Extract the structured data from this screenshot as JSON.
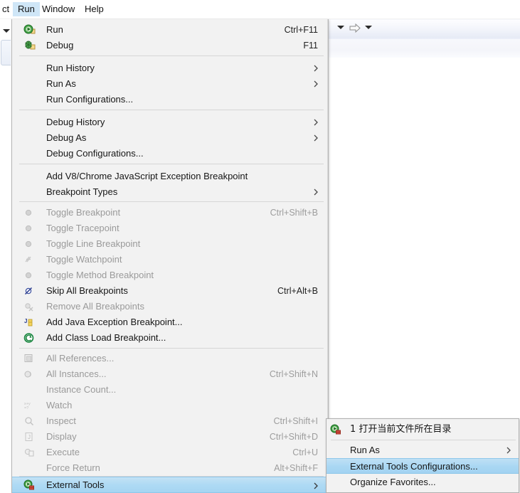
{
  "menubar": {
    "items": [
      {
        "label": "ct",
        "active": false
      },
      {
        "label": "Run",
        "active": true
      },
      {
        "label": "Window",
        "active": false
      },
      {
        "label": "Help",
        "active": false
      }
    ]
  },
  "toolbar": {
    "icons": [
      "caret-down-icon",
      "arrow-right-icon",
      "caret-down-icon"
    ]
  },
  "menu": {
    "title": "Run",
    "highlight_color": "#a9d7f3",
    "items": [
      {
        "label": "Run",
        "accel": "Ctrl+F11",
        "icon": "run-icon",
        "disabled": false,
        "submenu": false
      },
      {
        "label": "Debug",
        "accel": "F11",
        "icon": "debug-icon",
        "disabled": false,
        "submenu": false
      },
      {
        "label": "Run History",
        "accel": "",
        "icon": "",
        "disabled": false,
        "submenu": true
      },
      {
        "label": "Run As",
        "accel": "",
        "icon": "",
        "disabled": false,
        "submenu": true
      },
      {
        "label": "Run Configurations...",
        "accel": "",
        "icon": "",
        "disabled": false,
        "submenu": false
      },
      {
        "label": "Debug History",
        "accel": "",
        "icon": "",
        "disabled": false,
        "submenu": true
      },
      {
        "label": "Debug As",
        "accel": "",
        "icon": "",
        "disabled": false,
        "submenu": true
      },
      {
        "label": "Debug Configurations...",
        "accel": "",
        "icon": "",
        "disabled": false,
        "submenu": false
      },
      {
        "label": "Add V8/Chrome JavaScript Exception Breakpoint",
        "accel": "",
        "icon": "",
        "disabled": false,
        "submenu": false
      },
      {
        "label": "Breakpoint Types",
        "accel": "",
        "icon": "",
        "disabled": false,
        "submenu": true
      },
      {
        "label": "Toggle Breakpoint",
        "accel": "Ctrl+Shift+B",
        "icon": "breakpoint-icon",
        "disabled": true,
        "submenu": false
      },
      {
        "label": "Toggle Tracepoint",
        "accel": "",
        "icon": "breakpoint-icon",
        "disabled": true,
        "submenu": false
      },
      {
        "label": "Toggle Line Breakpoint",
        "accel": "",
        "icon": "breakpoint-icon",
        "disabled": true,
        "submenu": false
      },
      {
        "label": "Toggle Watchpoint",
        "accel": "",
        "icon": "watchpoint-icon",
        "disabled": true,
        "submenu": false
      },
      {
        "label": "Toggle Method Breakpoint",
        "accel": "",
        "icon": "breakpoint-icon",
        "disabled": true,
        "submenu": false
      },
      {
        "label": "Skip All Breakpoints",
        "accel": "Ctrl+Alt+B",
        "icon": "skip-breakpoints-icon",
        "disabled": false,
        "submenu": false
      },
      {
        "label": "Remove All Breakpoints",
        "accel": "",
        "icon": "remove-breakpoints-icon",
        "disabled": true,
        "submenu": false
      },
      {
        "label": "Add Java Exception Breakpoint...",
        "accel": "",
        "icon": "java-exception-icon",
        "disabled": false,
        "submenu": false
      },
      {
        "label": "Add Class Load Breakpoint...",
        "accel": "",
        "icon": "class-load-icon",
        "disabled": false,
        "submenu": false
      },
      {
        "label": "All References...",
        "accel": "",
        "icon": "all-references-icon",
        "disabled": true,
        "submenu": false
      },
      {
        "label": "All Instances...",
        "accel": "Ctrl+Shift+N",
        "icon": "all-instances-icon",
        "disabled": true,
        "submenu": false
      },
      {
        "label": "Instance Count...",
        "accel": "",
        "icon": "",
        "disabled": true,
        "submenu": false
      },
      {
        "label": "Watch",
        "accel": "",
        "icon": "watch-icon",
        "disabled": true,
        "submenu": false
      },
      {
        "label": "Inspect",
        "accel": "Ctrl+Shift+I",
        "icon": "inspect-icon",
        "disabled": true,
        "submenu": false
      },
      {
        "label": "Display",
        "accel": "Ctrl+Shift+D",
        "icon": "display-icon",
        "disabled": true,
        "submenu": false
      },
      {
        "label": "Execute",
        "accel": "Ctrl+U",
        "icon": "execute-icon",
        "disabled": true,
        "submenu": false
      },
      {
        "label": "Force Return",
        "accel": "Alt+Shift+F",
        "icon": "",
        "disabled": true,
        "submenu": false
      },
      {
        "label": "External Tools",
        "accel": "",
        "icon": "external-tools-icon",
        "disabled": false,
        "submenu": true,
        "selected": true
      }
    ]
  },
  "submenu": {
    "items": [
      {
        "label": "1 打开当前文件所在目录",
        "icon": "external-tool-run-icon",
        "submenu": false,
        "selected": false
      },
      {
        "label": "Run As",
        "icon": "",
        "submenu": true,
        "selected": false
      },
      {
        "label": "External Tools Configurations...",
        "icon": "",
        "submenu": false,
        "selected": true
      },
      {
        "label": "Organize Favorites...",
        "icon": "",
        "submenu": false,
        "selected": false
      }
    ]
  }
}
